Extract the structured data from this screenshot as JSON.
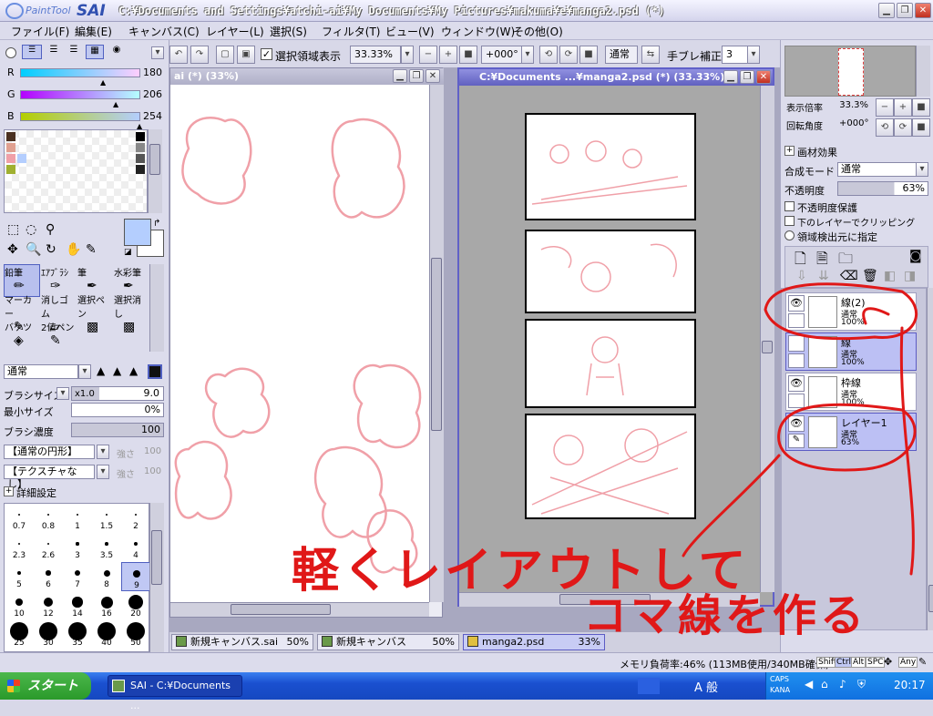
{
  "app": {
    "logo_text": "PaintTool",
    "logo_name": "SAI",
    "window_title": "C:¥Documents and Settings¥atchi-ai¥My Documents¥My Pictures¥makuma¥e¥manga2.psd (*)"
  },
  "menu": [
    "ファイル(F)",
    "編集(E)",
    "キャンバス(C)",
    "レイヤー(L)",
    "選択(S)",
    "フィルタ(T)",
    "ビュー(V)",
    "ウィンドウ(W)",
    "その他(O)"
  ],
  "toolbar": {
    "selection_display_label": "選択領域表示",
    "zoom_value": "33.33%",
    "rotation_value": "+000°",
    "blend_mode": "通常",
    "stabilizer_label": "手ブレ補正",
    "stabilizer_value": "3"
  },
  "color": {
    "r_label": "R",
    "r_value": "180",
    "g_label": "G",
    "g_value": "206",
    "b_label": "B",
    "b_value": "254",
    "primary_hex": "#b4cefe"
  },
  "tools": [
    {
      "label": "鉛筆"
    },
    {
      "label": "ｴｱﾌﾞﾗｼ"
    },
    {
      "label": "筆"
    },
    {
      "label": "水彩筆"
    },
    {
      "label": "マーカー"
    },
    {
      "label": "消しゴム"
    },
    {
      "label": "選択ペン"
    },
    {
      "label": "選択消し"
    },
    {
      "label": "バケツ"
    },
    {
      "label": "2値ペン"
    }
  ],
  "brush": {
    "mode": "通常",
    "size_label": "ブラシサイズ",
    "size_mult": "x1.0",
    "size_value": "9.0",
    "min_size_label": "最小サイズ",
    "min_size_value": "0%",
    "density_label": "ブラシ濃度",
    "density_value": "100",
    "shape": "【通常の円形】",
    "shape_strength_label": "強さ",
    "shape_strength": "100",
    "texture": "【テクスチャなし】",
    "texture_strength_label": "強さ",
    "texture_strength": "100",
    "detail_label": "詳細設定",
    "sizes": [
      "0.7",
      "0.8",
      "1",
      "1.5",
      "2",
      "2.3",
      "2.6",
      "3",
      "3.5",
      "4",
      "5",
      "6",
      "7",
      "8",
      "9",
      "10",
      "12",
      "14",
      "16",
      "20",
      "25",
      "30",
      "35",
      "40",
      "50"
    ]
  },
  "canvas_left": {
    "title": "ai (*) (33%)"
  },
  "canvas_right": {
    "title": "C:¥Documents ...¥manga2.psd (*) (33.33%)"
  },
  "overlay_text": {
    "line1": "軽くレイアウトして",
    "line2": "コマ線を作る"
  },
  "navigator": {
    "zoom_label": "表示倍率",
    "zoom_value": "33.3%",
    "angle_label": "回転角度",
    "angle_value": "+000°"
  },
  "layer_props": {
    "effect_label": "画材効果",
    "blend_label": "合成モード",
    "blend_value": "通常",
    "opacity_label": "不透明度",
    "opacity_value": "63%",
    "preserve_opacity": "不透明度保護",
    "clip_lower": "下のレイヤーでクリッピング",
    "area_source": "領域検出元に指定"
  },
  "layers": [
    {
      "name": "線(2)",
      "mode": "通常",
      "opacity": "100%",
      "selected": false
    },
    {
      "name": "線",
      "mode": "通常",
      "opacity": "100%",
      "selected": true
    },
    {
      "name": "枠線",
      "mode": "通常",
      "opacity": "100%",
      "selected": false
    },
    {
      "name": "レイヤー1",
      "mode": "通常",
      "opacity": "63%",
      "selected": true
    }
  ],
  "doc_tabs": [
    {
      "name": "新規キャンバス.sai",
      "zoom": "50%"
    },
    {
      "name": "新規キャンバス",
      "zoom": "50%"
    },
    {
      "name": "manga2.psd",
      "zoom": "33%"
    }
  ],
  "status": {
    "memory": "メモリ負荷率:46% (113MB使用/340MB確保)",
    "keys": [
      "Shift",
      "Ctrl",
      "Alt",
      "SPC",
      "Any"
    ]
  },
  "taskbar": {
    "start_label": "スタート",
    "task_label": "SAI - C:¥Documents ...",
    "ime": "A 般",
    "caps": "CAPS",
    "kana": "KANA",
    "time": "20:17"
  },
  "colors": {
    "sketch": "#f0a0a8",
    "annotation": "#e01818",
    "panel": "#dcdcec",
    "selection": "#bcc0f4"
  }
}
